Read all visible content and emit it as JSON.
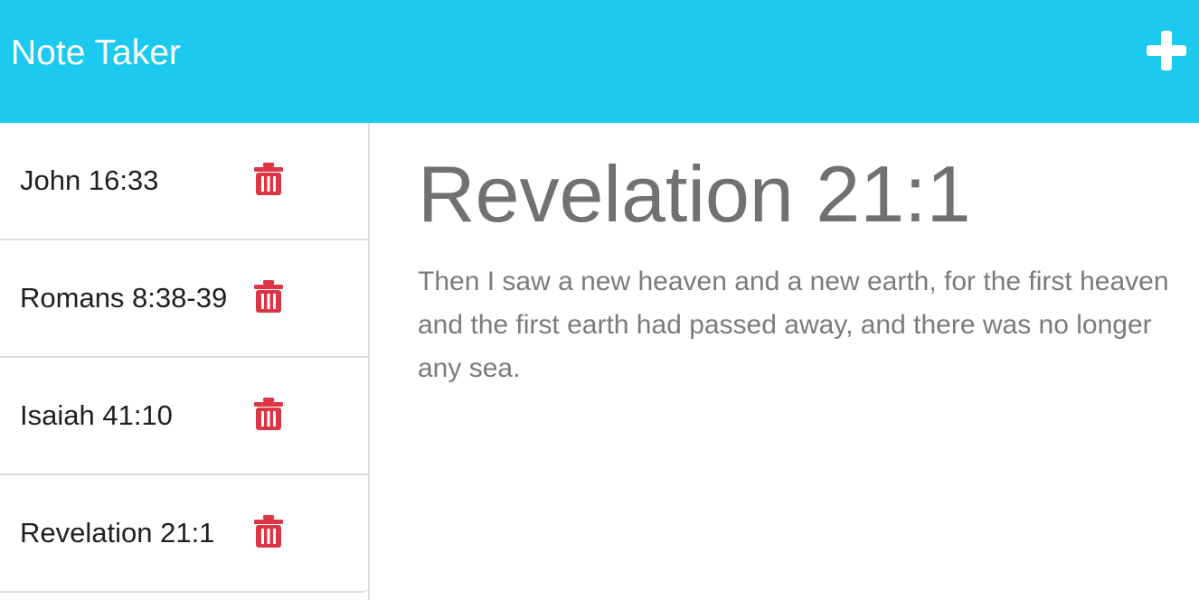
{
  "header": {
    "brand": "Note Taker",
    "add_icon": "plus-icon"
  },
  "sidebar": {
    "delete_icon": "trash-icon",
    "delete_color": "#dc3545",
    "items": [
      {
        "label": "John 16:33"
      },
      {
        "label": "Romans 8:38-39"
      },
      {
        "label": "Isaiah 41:10"
      },
      {
        "label": "Revelation 21:1"
      }
    ]
  },
  "editor": {
    "title": "Revelation 21:1",
    "body": "Then I saw a new heaven and a new earth, for the first heaven and the first earth had passed away, and there was no longer any sea."
  },
  "colors": {
    "navbar": "#1bcaee",
    "text_muted": "#717171"
  }
}
